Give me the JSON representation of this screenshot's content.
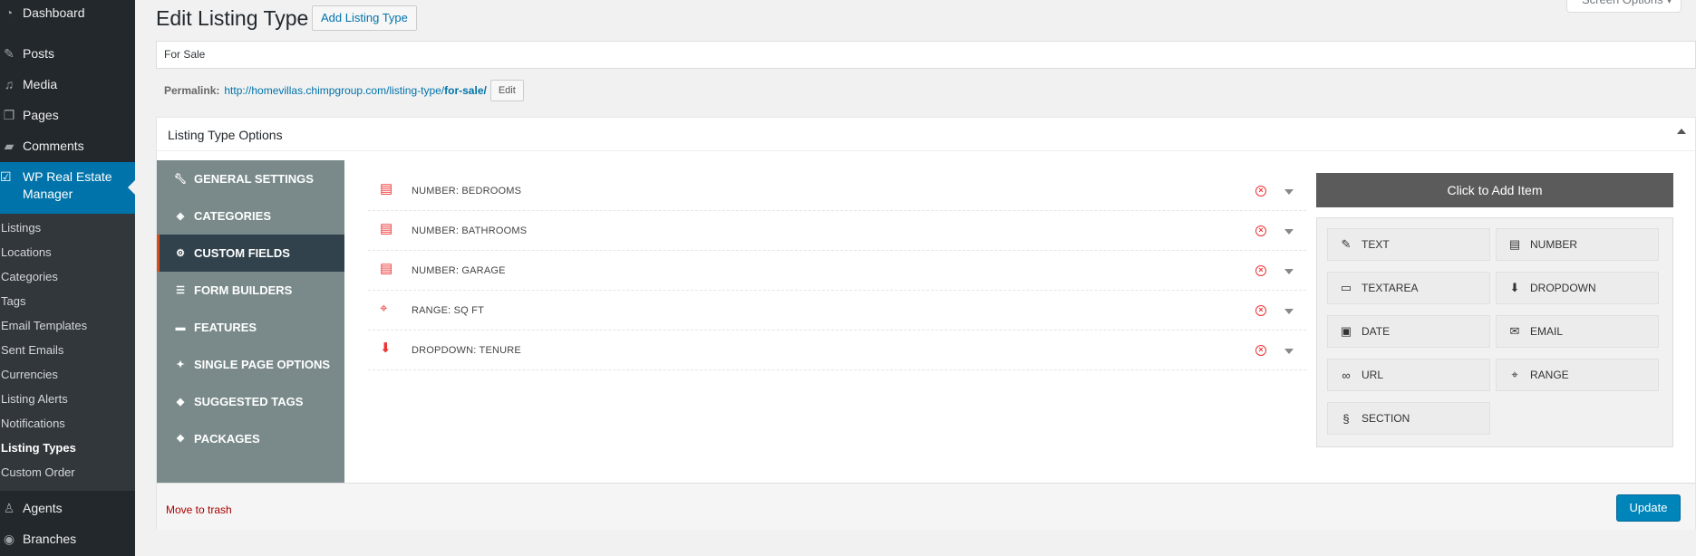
{
  "admin_menu": {
    "top_items": [
      {
        "label": "Dashboard",
        "icon": "dashboard-icon"
      },
      {
        "label": "Posts",
        "icon": "pin-icon"
      },
      {
        "label": "Media",
        "icon": "media-icon"
      },
      {
        "label": "Pages",
        "icon": "pages-icon"
      },
      {
        "label": "Comments",
        "icon": "comment-icon"
      }
    ],
    "active": {
      "label": "WP Real Estate Manager",
      "icon": "check-icon"
    },
    "submenu": [
      "Listings",
      "Locations",
      "Categories",
      "Tags",
      "Email Templates",
      "Sent Emails",
      "Currencies",
      "Listing Alerts",
      "Notifications",
      "Listing Types",
      "Custom Order"
    ],
    "current_sub": "Listing Types",
    "bottom_items": [
      {
        "label": "Agents",
        "icon": "agent-icon"
      },
      {
        "label": "Branches",
        "icon": "branch-icon"
      }
    ]
  },
  "header": {
    "title": "Edit Listing Type",
    "add_new": "Add Listing Type",
    "screen_options": "Screen Options ▾"
  },
  "title_field": {
    "value": "For Sale"
  },
  "permalink": {
    "label": "Permalink:",
    "url_base": "http://homevillas.chimpgroup.com/listing-type/",
    "slug": "for-sale/",
    "edit_label": "Edit"
  },
  "metabox": {
    "title": "Listing Type Options",
    "tabs": [
      {
        "label": "GENERAL SETTINGS",
        "icon": "wrench-icon"
      },
      {
        "label": "CATEGORIES",
        "icon": "layers-icon"
      },
      {
        "label": "CUSTOM FIELDS",
        "icon": "settings-icon"
      },
      {
        "label": "FORM BUILDERS",
        "icon": "form-icon"
      },
      {
        "label": "FEATURES",
        "icon": "feature-icon"
      },
      {
        "label": "SINGLE PAGE OPTIONS",
        "icon": "wrench-icon"
      },
      {
        "label": "SUGGESTED TAGS",
        "icon": "tag-icon"
      },
      {
        "label": "PACKAGES",
        "icon": "package-icon"
      }
    ],
    "active_tab": "CUSTOM FIELDS",
    "fields": [
      {
        "label": "NUMBER: BEDROOMS",
        "icon": "number-icon"
      },
      {
        "label": "NUMBER: BATHROOMS",
        "icon": "number-icon"
      },
      {
        "label": "NUMBER: GARAGE",
        "icon": "number-icon"
      },
      {
        "label": "RANGE: SQ FT",
        "icon": "range-icon"
      },
      {
        "label": "DROPDOWN: TENURE",
        "icon": "dropdown-icon"
      }
    ],
    "add_item": {
      "header": "Click to Add Item",
      "types": [
        {
          "label": "TEXT",
          "icon": "edit-icon"
        },
        {
          "label": "NUMBER",
          "icon": "number-icon"
        },
        {
          "label": "TEXTAREA",
          "icon": "comment-icon"
        },
        {
          "label": "DROPDOWN",
          "icon": "arrow-down-icon"
        },
        {
          "label": "DATE",
          "icon": "date-icon"
        },
        {
          "label": "EMAIL",
          "icon": "email-icon"
        },
        {
          "label": "URL",
          "icon": "link-icon"
        },
        {
          "label": "RANGE",
          "icon": "range-icon"
        },
        {
          "label": "SECTION",
          "icon": "section-icon"
        }
      ]
    },
    "trash_label": "Move to trash",
    "update_label": "Update"
  },
  "colors": {
    "sidebar": "#23282d",
    "active": "#0073aa",
    "tab_bg": "#7a8a8a",
    "tab_active": "#32424c",
    "field_icon": "#ee3333",
    "update": "#0085ba"
  }
}
